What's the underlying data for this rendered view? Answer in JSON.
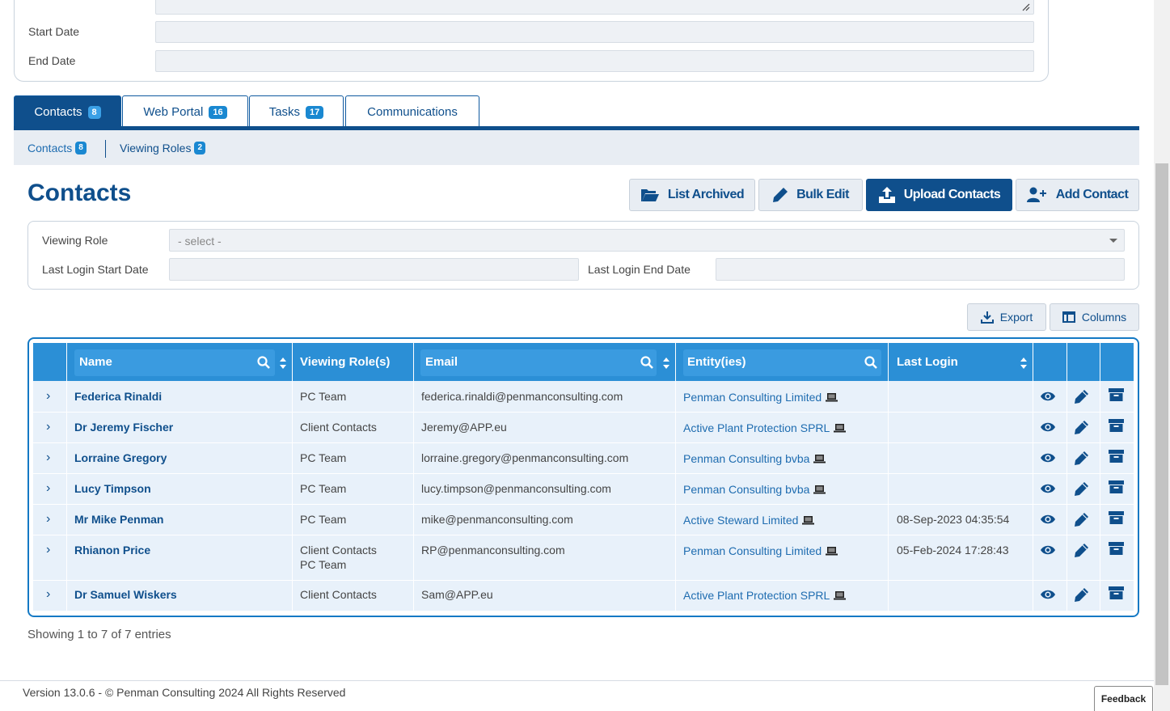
{
  "details_form": {
    "start_date_label": "Start Date",
    "end_date_label": "End Date",
    "start_date_value": "",
    "end_date_value": ""
  },
  "tabs": [
    {
      "label": "Contacts",
      "count": "8"
    },
    {
      "label": "Web Portal",
      "count": "16"
    },
    {
      "label": "Tasks",
      "count": "17"
    },
    {
      "label": "Communications"
    }
  ],
  "subnav": [
    {
      "label": "Contacts",
      "count": "8"
    },
    {
      "label": "Viewing Roles",
      "count": "2"
    }
  ],
  "page": {
    "title": "Contacts",
    "buttons": {
      "list_archived": "List Archived",
      "bulk_edit": "Bulk Edit",
      "upload_contacts": "Upload Contacts",
      "add_contact": "Add Contact"
    }
  },
  "filters": {
    "viewing_role_label": "Viewing Role",
    "viewing_role_selected": "- select -",
    "last_login_start_label": "Last Login Start Date",
    "last_login_end_label": "Last Login End Date"
  },
  "toolbar": {
    "export": "Export",
    "columns": "Columns"
  },
  "table": {
    "columns": [
      "Name",
      "Viewing Role(s)",
      "Email",
      "Entity(ies)",
      "Last Login"
    ],
    "rows": [
      {
        "name": "Federica Rinaldi",
        "roles": [
          "PC Team"
        ],
        "email": "federica.rinaldi@penmanconsulting.com",
        "entity": "Penman Consulting Limited",
        "last_login": ""
      },
      {
        "name": "Dr Jeremy Fischer",
        "roles": [
          "Client Contacts"
        ],
        "email": "Jeremy@APP.eu",
        "entity": "Active Plant Protection SPRL",
        "last_login": ""
      },
      {
        "name": "Lorraine Gregory",
        "roles": [
          "PC Team"
        ],
        "email": "lorraine.gregory@penmanconsulting.com",
        "entity": "Penman Consulting bvba",
        "last_login": ""
      },
      {
        "name": "Lucy Timpson",
        "roles": [
          "PC Team"
        ],
        "email": "lucy.timpson@penmanconsulting.com",
        "entity": "Penman Consulting bvba",
        "last_login": ""
      },
      {
        "name": "Mr Mike Penman",
        "roles": [
          "PC Team"
        ],
        "email": "mike@penmanconsulting.com",
        "entity": "Active Steward Limited",
        "last_login": "08-Sep-2023 04:35:54"
      },
      {
        "name": "Rhianon Price",
        "roles": [
          "Client Contacts",
          "PC Team"
        ],
        "email": "RP@penmanconsulting.com",
        "entity": "Penman Consulting Limited",
        "last_login": "05-Feb-2024 17:28:43"
      },
      {
        "name": "Dr Samuel Wiskers",
        "roles": [
          "Client Contacts"
        ],
        "email": "Sam@APP.eu",
        "entity": "Active Plant Protection SPRL",
        "last_login": ""
      }
    ],
    "entries_text": "Showing 1 to 7 of 7 entries"
  },
  "footer": {
    "text": "Version 13.0.6 - © Penman Consulting 2024 All Rights Reserved",
    "feedback": "Feedback"
  },
  "colors": {
    "primary": "#0f4f8c",
    "header_blue": "#2b8fd6",
    "row_bg": "#e8f1fa"
  }
}
